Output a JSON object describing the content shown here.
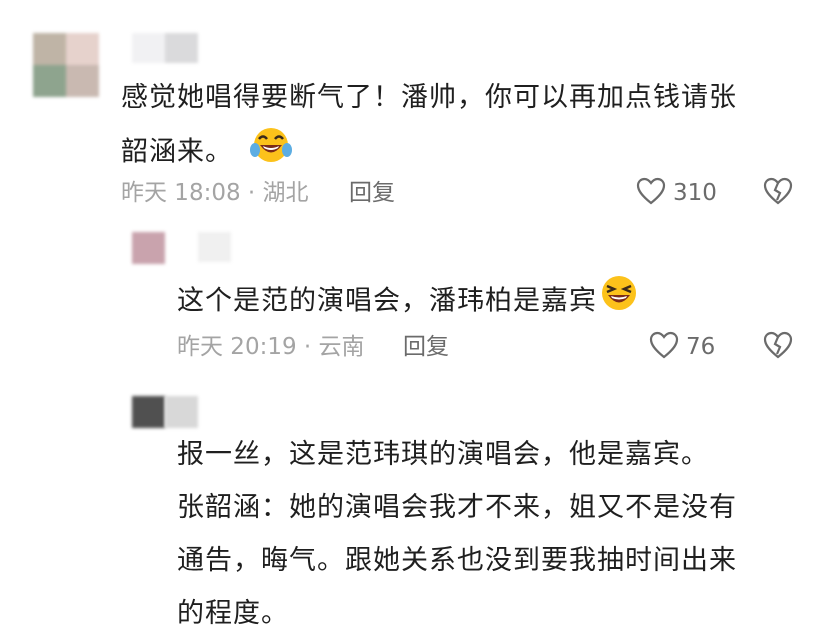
{
  "comment": {
    "text_line1": "感觉她唱得要断气了！潘帅，你可以再加点钱请张",
    "text_line2": "韶涵来。",
    "meta": "昨天 18:08 · 湖北",
    "reply_label": "回复",
    "likes": "310"
  },
  "replies": [
    {
      "text_line1": "这个是范的演唱会，潘玮柏是嘉宾",
      "meta": "昨天 20:19 · 云南",
      "reply_label": "回复",
      "likes": "76"
    },
    {
      "text_line1": "报一丝，这是范玮琪的演唱会，他是嘉宾。",
      "text_line2": "张韶涵：她的演唱会我才不来，姐又不是没有",
      "text_line3": "通告，晦气。跟她关系也没到要我抽时间出来",
      "text_line4": "的程度。"
    }
  ],
  "icons": {
    "like": "heart-outline-icon",
    "dislike": "broken-heart-icon",
    "emoji1": "laughing-tears-emoji",
    "emoji2": "laughing-emoji"
  },
  "colors": {
    "text": "#1f1f1f",
    "meta": "#a4a4a4",
    "action": "#6b6b6b"
  }
}
